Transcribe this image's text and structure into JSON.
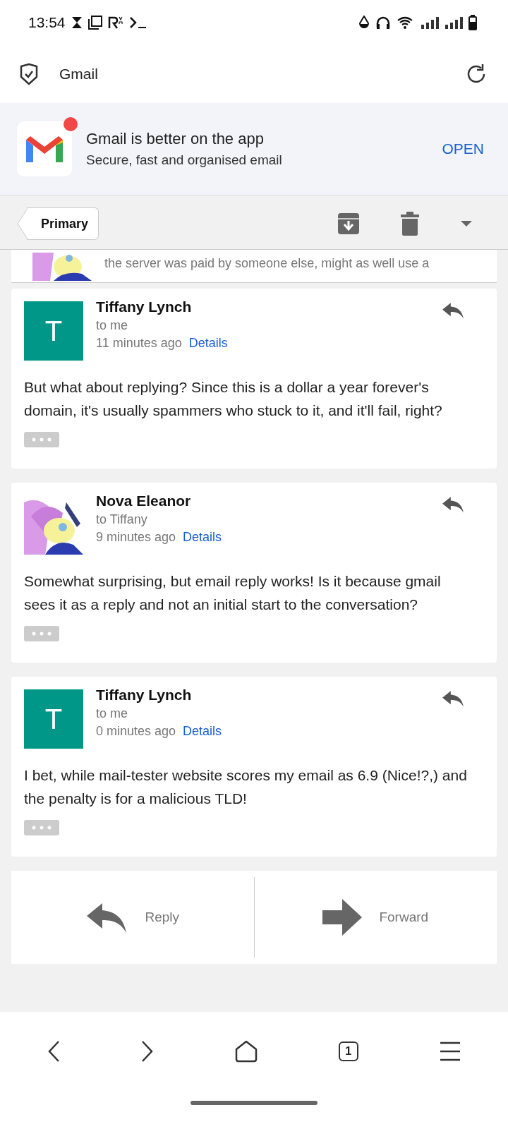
{
  "status_bar": {
    "time": "13:54"
  },
  "top_bar": {
    "title": "Gmail"
  },
  "app_banner": {
    "title": "Gmail is better on the app",
    "subtitle": "Secure, fast and organised email",
    "action": "OPEN",
    "notification_dot": true
  },
  "toolbar": {
    "back_label": "Primary"
  },
  "previous_message": {
    "snippet": "the server was paid by someone else, might as well use a"
  },
  "messages": [
    {
      "sender": "Tiffany Lynch",
      "avatar": {
        "kind": "letter",
        "letter": "T"
      },
      "recipient": "to me",
      "time": "11 minutes ago",
      "details": "Details",
      "body": "But what about replying? Since this is a dollar a year forever's domain, it's usually spammers who stuck to it, and it'll fail, right?"
    },
    {
      "sender": "Nova Eleanor",
      "recipient": "to Tiffany",
      "time": "9 minutes ago",
      "details": "Details",
      "body": "Somewhat surprising, but email reply works! Is it because gmail sees it as a reply and not an initial start to the conversation?"
    },
    {
      "sender": "Tiffany Lynch",
      "avatar": {
        "kind": "letter",
        "letter": "T"
      },
      "recipient": "to me",
      "time": "0 minutes ago",
      "details": "Details",
      "body": "I bet, while mail-tester website scores my email as 6.9 (Nice!?,) and the penalty is for a malicious TLD!"
    }
  ],
  "actions": [
    {
      "kind": "reply",
      "label": "Reply"
    },
    {
      "kind": "forward",
      "label": "Forward"
    }
  ],
  "browser_nav": {
    "tab_count": "1"
  }
}
